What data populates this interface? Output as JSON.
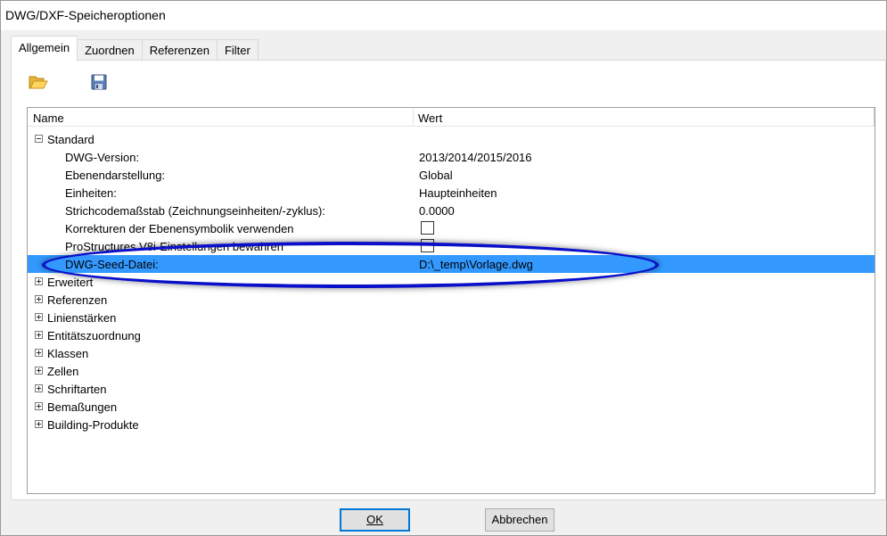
{
  "window": {
    "title": "DWG/DXF-Speicheroptionen"
  },
  "tabs": [
    {
      "label": "Allgemein",
      "active": true
    },
    {
      "label": "Zuordnen",
      "active": false
    },
    {
      "label": "Referenzen",
      "active": false
    },
    {
      "label": "Filter",
      "active": false
    }
  ],
  "toolbar": {
    "open_icon": "folder-open-icon",
    "save_icon": "floppy-disk-icon"
  },
  "grid": {
    "headers": {
      "name": "Name",
      "value": "Wert"
    },
    "standard": {
      "label": "Standard",
      "rows": [
        {
          "label": "DWG-Version:",
          "value": "2013/2014/2015/2016"
        },
        {
          "label": "Ebenendarstellung:",
          "value": "Global"
        },
        {
          "label": "Einheiten:",
          "value": "Haupteinheiten"
        },
        {
          "label": "Strichcodemaßstab (Zeichnungseinheiten/-zyklus):",
          "value": "0.0000"
        },
        {
          "label": "Korrekturen der Ebenensymbolik verwenden",
          "checked": false
        },
        {
          "label": "ProStructures V8i-Einstellungen bewahren",
          "checked": false
        },
        {
          "label": "DWG-Seed-Datei:",
          "value": "D:\\_temp\\Vorlage.dwg",
          "selected": true
        }
      ]
    },
    "groups": [
      "Erweitert",
      "Referenzen",
      "Linienstärken",
      "Entitätszuordnung",
      "Klassen",
      "Zellen",
      "Schriftarten",
      "Bemaßungen",
      "Building-Produkte"
    ]
  },
  "buttons": {
    "ok": "OK",
    "cancel": "Abbrechen"
  },
  "colors": {
    "selection": "#3399ff",
    "annotation_ellipse": "#0a10c8",
    "default_button_border": "#0078d7"
  }
}
